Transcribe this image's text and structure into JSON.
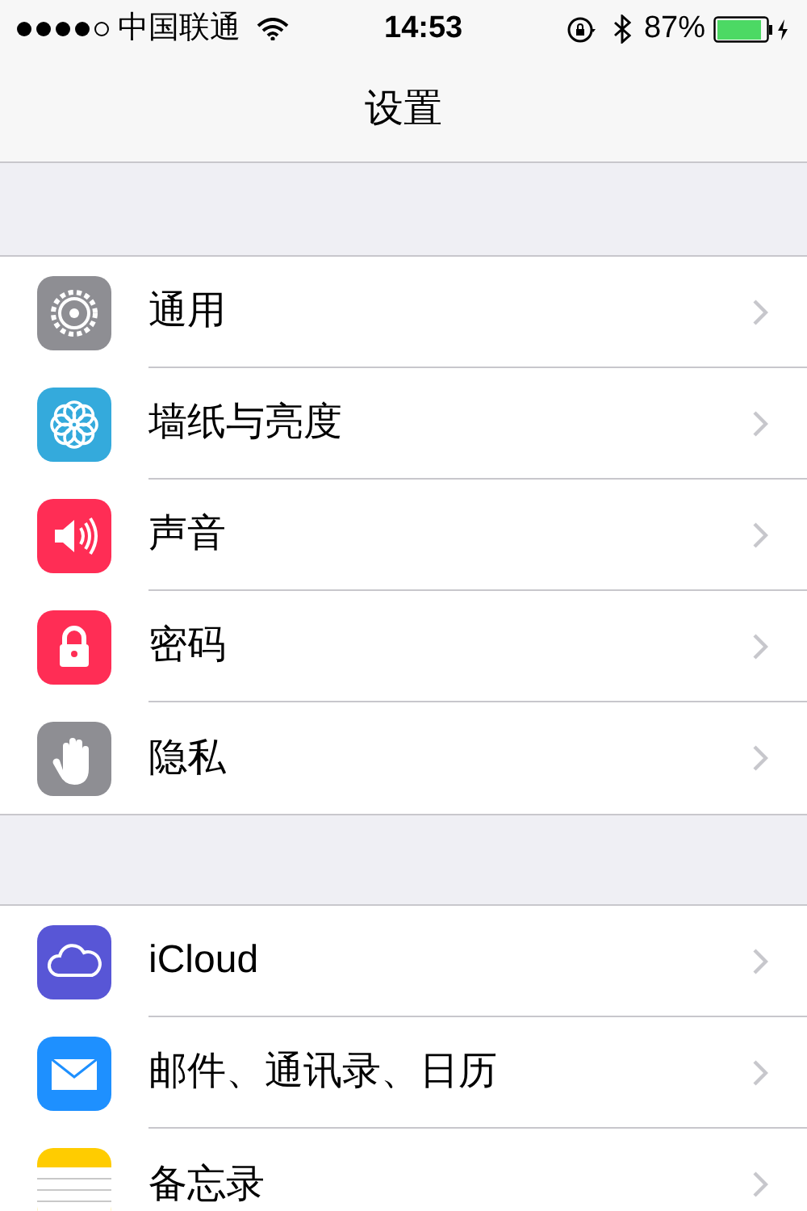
{
  "status_bar": {
    "carrier": "中国联通",
    "time": "14:53",
    "battery": "87%"
  },
  "nav": {
    "title": "设置"
  },
  "groups": [
    {
      "items": [
        {
          "label": "通用",
          "kind": "gear",
          "color": "#8e8e93"
        },
        {
          "label": "墙纸与亮度",
          "kind": "flower",
          "color": "#34aadc"
        },
        {
          "label": "声音",
          "kind": "speaker",
          "color": "#ff2d55"
        },
        {
          "label": "密码",
          "kind": "lock",
          "color": "#ff2d55"
        },
        {
          "label": "隐私",
          "kind": "hand",
          "color": "#8e8e93"
        }
      ]
    },
    {
      "items": [
        {
          "label": "iCloud",
          "kind": "cloud",
          "color": "#5856d6"
        },
        {
          "label": "邮件、通讯录、日历",
          "kind": "mail",
          "color": "#1e90ff"
        },
        {
          "label": "备忘录",
          "kind": "notes",
          "color": "#ffcc00"
        }
      ]
    }
  ]
}
